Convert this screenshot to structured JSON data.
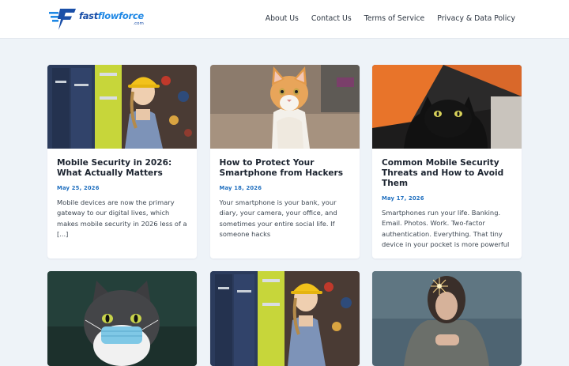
{
  "site": {
    "logo_prefix": "fast",
    "logo_accent": "flowforce",
    "logo_suffix": ".com",
    "brand_colors": {
      "dark": "#1a4fa8",
      "light": "#1f88e5"
    }
  },
  "nav": {
    "items": [
      {
        "label": "About Us"
      },
      {
        "label": "Contact Us"
      },
      {
        "label": "Terms of Service"
      },
      {
        "label": "Privacy & Data Policy"
      }
    ]
  },
  "posts": [
    {
      "title": "Mobile Security in 2026: What Actually Matters",
      "date": "May 25, 2026",
      "excerpt": "Mobile devices are now the primary gateway to our digital lives, which makes mobile security in 2026 less of a [...]",
      "image": "worker-in-hard-hat-photo"
    },
    {
      "title": "How to Protect Your Smartphone from Hackers",
      "date": "May 18, 2026",
      "excerpt": "Your smartphone is your bank, your diary, your camera, your office, and sometimes your entire social life. If someone hacks",
      "image": "orange-white-cat-photo"
    },
    {
      "title": "Common Mobile Security Threats and How to Avoid Them",
      "date": "May 17, 2026",
      "excerpt": "Smartphones run your life. Banking. Email. Photos. Work. Two-factor authentication. Everything. That tiny device in your pocket is more powerful",
      "image": "black-cat-in-tent-photo"
    },
    {
      "image": "cat-with-face-mask-photo"
    },
    {
      "image": "worker-in-hard-hat-photo"
    },
    {
      "image": "woman-with-sparkler-photo"
    }
  ]
}
